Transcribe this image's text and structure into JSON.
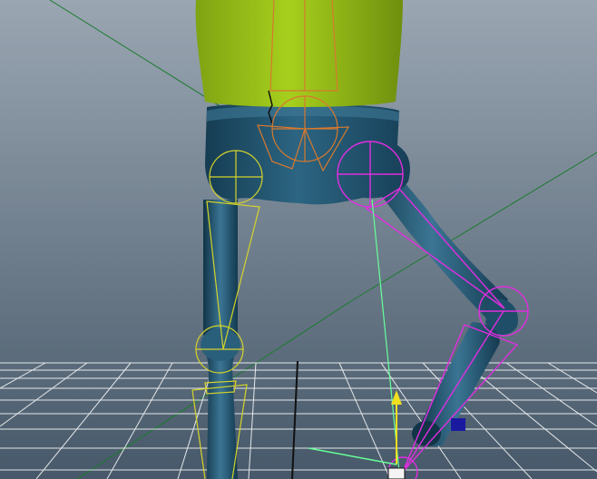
{
  "viewport": {
    "name": "3d-perspective-viewport",
    "background_top": "#9aa6b2",
    "background_bottom": "#465869"
  },
  "colors": {
    "shirt": "#9bc216",
    "shirt_dark": "#6f8f0e",
    "pants": "#1f4e68",
    "pants_light": "#3f7a96",
    "grid": "#ffffff",
    "grid_axis": "#111111",
    "spine_bone": "#d8792e",
    "left_leg_bone": "#d5d42a",
    "right_leg_selected": "#e02ee0",
    "ik_handle_line": "#66ff99",
    "world_axis_green": "#1b7a2e",
    "manipulator_yellow": "#f0e020",
    "manipulator_blue": "#1a1aa0"
  },
  "scene_objects": [
    {
      "name": "shirt-mesh",
      "kind": "geometry"
    },
    {
      "name": "pants-mesh",
      "kind": "geometry"
    },
    {
      "name": "spine-joint",
      "kind": "joint"
    },
    {
      "name": "left-hip-joint",
      "kind": "joint"
    },
    {
      "name": "left-knee-joint",
      "kind": "joint"
    },
    {
      "name": "right-hip-joint",
      "kind": "joint",
      "selected": true
    },
    {
      "name": "right-knee-joint",
      "kind": "joint",
      "selected": true
    },
    {
      "name": "ik-handle",
      "kind": "handle"
    },
    {
      "name": "move-manipulator",
      "kind": "tool"
    }
  ]
}
